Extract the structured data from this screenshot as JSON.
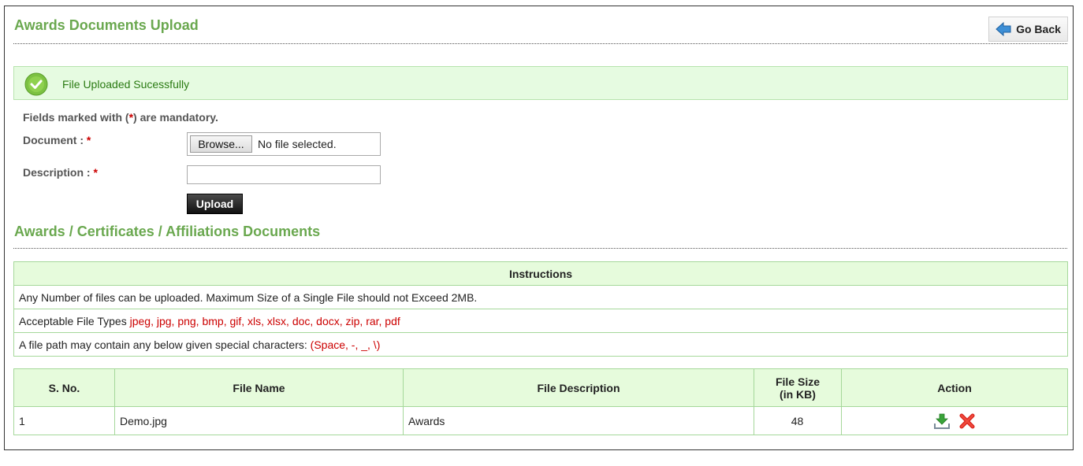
{
  "header": {
    "title": "Awards Documents Upload",
    "go_back_label": "Go Back",
    "go_back_icon": "arrow-left-icon"
  },
  "alert": {
    "message": "File Uploaded Sucessfully",
    "icon": "check-circle-icon"
  },
  "form": {
    "mandatory_prefix": "Fields marked with (",
    "mandatory_star": "*",
    "mandatory_suffix": ") are mandatory.",
    "document_label": "Document :",
    "description_label": "Description :",
    "required_mark": "*",
    "browse_label": "Browse...",
    "file_status": "No file selected.",
    "description_value": "",
    "upload_label": "Upload"
  },
  "section": {
    "title": "Awards / Certificates / Affiliations Documents"
  },
  "instructions": {
    "header": "Instructions",
    "line1": "Any Number of files can be uploaded. Maximum Size of a Single File should not Exceed 2MB.",
    "line2_text": "Acceptable File Types ",
    "line2_highlight": "jpeg, jpg, png, bmp, gif, xls, xlsx, doc, docx, zip, rar, pdf",
    "line3_text": "A file path may contain any below given special characters: ",
    "line3_highlight": "(Space, -, _, \\)"
  },
  "files_table": {
    "columns": [
      "S. No.",
      "File Name",
      "File Description",
      "File Size",
      "(in KB)",
      "Action"
    ],
    "rows": [
      {
        "sno": "1",
        "name": "Demo.jpg",
        "description": "Awards",
        "size": "48",
        "download_icon": "download-icon",
        "delete_icon": "delete-icon"
      }
    ]
  },
  "colors": {
    "accent_green": "#6aa84f",
    "required_red": "#cc0000",
    "table_header_bg": "#e6fbdc",
    "success_bg": "#e6fbe1"
  }
}
